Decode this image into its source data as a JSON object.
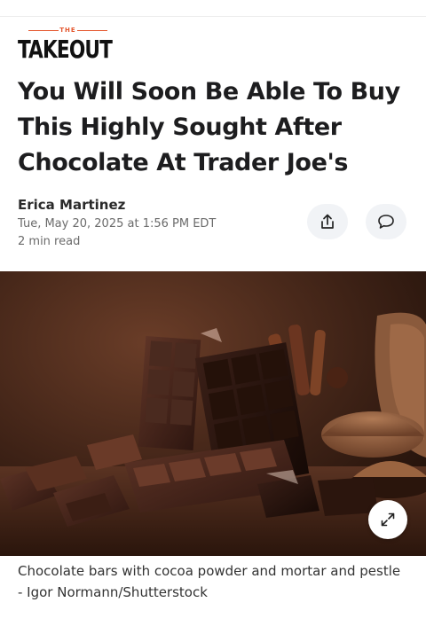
{
  "brand": {
    "small": "THE",
    "name": "TAKEOUT",
    "accent_color": "#e4572e"
  },
  "article": {
    "title": "You Will Soon Be Able To Buy This Highly Sought After Chocolate At Trader Joe's",
    "author": "Erica Martinez",
    "date": "Tue, May 20, 2025 at 1:56 PM EDT",
    "read_time": "2 min read"
  },
  "actions": {
    "share_icon": "share-icon",
    "comment_icon": "comment-icon"
  },
  "image": {
    "description_icon": "expand-icon",
    "caption": "Chocolate bars with cocoa powder and mortar and pestle - Igor Normann/Shutterstock"
  }
}
